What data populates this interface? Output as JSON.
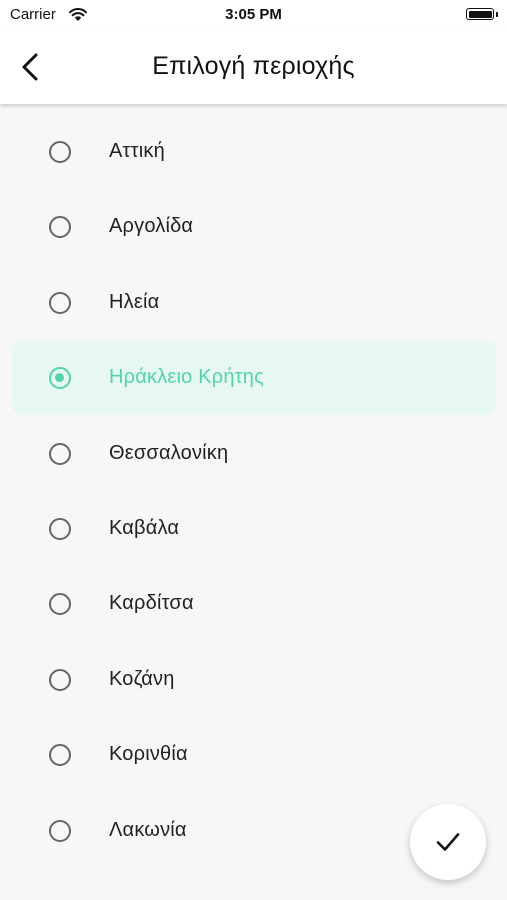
{
  "status_bar": {
    "carrier": "Carrier",
    "time": "3:05 PM",
    "icons": [
      "wifi-icon",
      "battery-icon"
    ]
  },
  "header": {
    "title": "Επιλογή περιοχής",
    "back_icon": "chevron-left-icon"
  },
  "regions": [
    {
      "label": "Αττική",
      "selected": false
    },
    {
      "label": "Αργολίδα",
      "selected": false
    },
    {
      "label": "Ηλεία",
      "selected": false
    },
    {
      "label": "Ηράκλειο Κρήτης",
      "selected": true
    },
    {
      "label": "Θεσσαλονίκη",
      "selected": false
    },
    {
      "label": "Καβάλα",
      "selected": false
    },
    {
      "label": "Καρδίτσα",
      "selected": false
    },
    {
      "label": "Κοζάνη",
      "selected": false
    },
    {
      "label": "Κορινθία",
      "selected": false
    },
    {
      "label": "Λακωνία",
      "selected": false
    }
  ],
  "fab": {
    "icon": "check-icon"
  },
  "colors": {
    "accent": "#4fd6a8",
    "selected_background": "#e7f8f1",
    "background": "#f7f7f7"
  }
}
